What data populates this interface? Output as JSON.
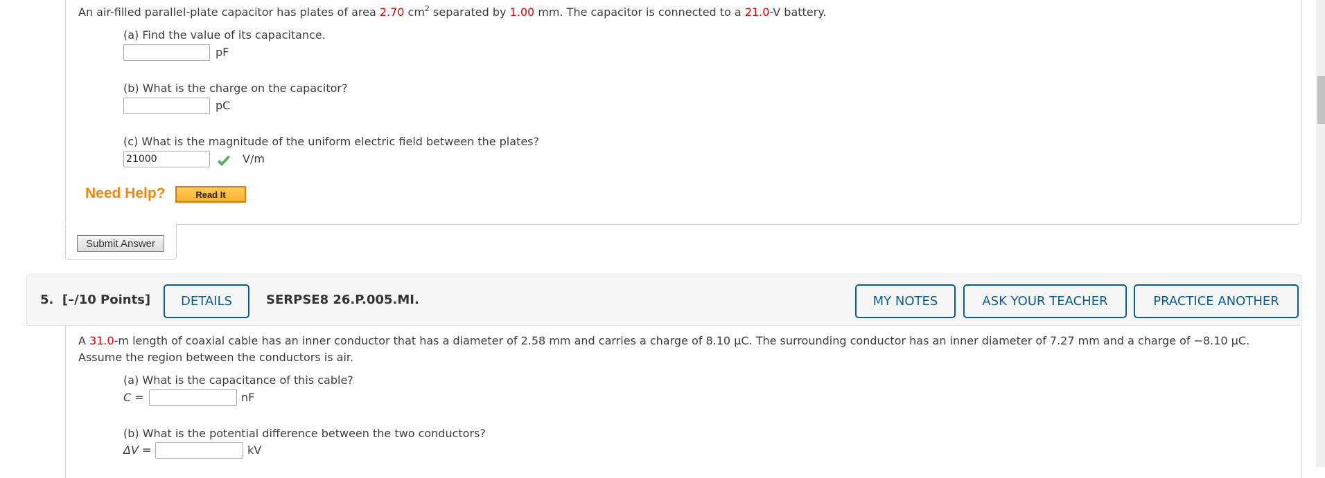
{
  "question4": {
    "problem": {
      "pre": "An air-filled parallel-plate capacitor has plates of area ",
      "area_value": "2.70",
      "area_unit": " cm",
      "area_exp": "2",
      "mid": " separated by ",
      "sep_value": "1.00",
      "mid2": " mm. The capacitor is connected to a ",
      "volt_value": "21.0",
      "post": "-V battery."
    },
    "parts": [
      {
        "label": "(a) Find the value of its capacitance.",
        "value": "",
        "unit": "pF"
      },
      {
        "label": "(b) What is the charge on the capacitor?",
        "value": "",
        "unit": "pC"
      },
      {
        "label": "(c) What is the magnitude of the uniform electric field between the plates?",
        "value": "21000",
        "unit": "V/m",
        "status": "correct"
      }
    ],
    "need_help": "Need Help?",
    "read_it": "Read It",
    "submit": "Submit Answer"
  },
  "question5": {
    "number": "5.",
    "points": "[–/10 Points]",
    "details": "DETAILS",
    "code": "SERPSE8 26.P.005.MI.",
    "my_notes": "MY NOTES",
    "ask_teacher": "ASK YOUR TEACHER",
    "practice_another": "PRACTICE ANOTHER",
    "problem": {
      "pre": "A ",
      "length_value": "31.0",
      "line1_rest": "-m length of coaxial cable has an inner conductor that has a diameter of 2.58 mm and carries a charge of 8.10 μC. The surrounding conductor has an inner diameter of 7.27 mm and a charge of −8.10 μC.",
      "line2": "Assume the region between the conductors is air."
    },
    "parts": [
      {
        "label": "(a) What is the capacitance of this cable?",
        "var": "C",
        "eq": " =",
        "value": "",
        "unit": "nF"
      },
      {
        "label": "(b) What is the potential difference between the two conductors?",
        "var": "ΔV",
        "eq": " =",
        "value": "",
        "unit": "kV"
      }
    ]
  },
  "colors": {
    "given_value": "#e60000",
    "accent_blue": "#0b5b8e",
    "need_help_orange": "#f0850f",
    "check_green": "#4caf50"
  }
}
